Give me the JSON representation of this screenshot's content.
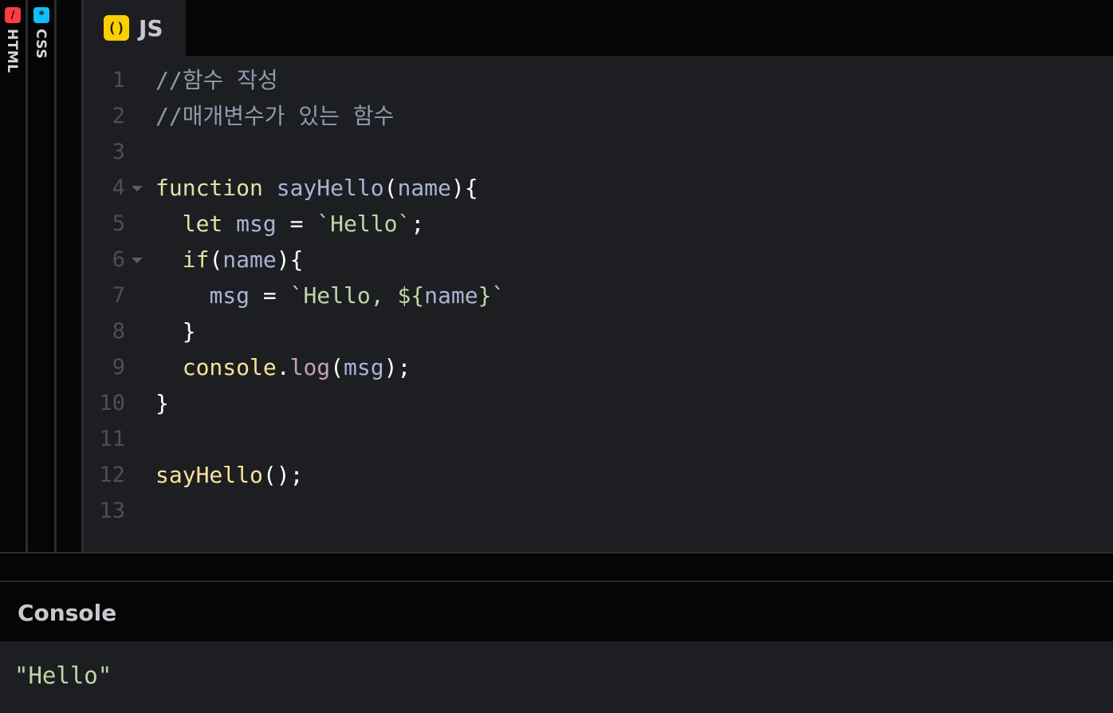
{
  "panels": {
    "html": {
      "label": "HTML",
      "icon": "html-icon",
      "color": "#ff3c41",
      "glyph": "/"
    },
    "css": {
      "label": "CSS",
      "icon": "css-icon",
      "color": "#0ebeff",
      "glyph": "*"
    }
  },
  "editor": {
    "tab": {
      "label": "JS",
      "icon": "js-icon",
      "color": "#fcd000",
      "glyph": "()"
    },
    "lines": [
      {
        "num": "1",
        "fold": false,
        "indent": "",
        "tokens": [
          {
            "t": "//함수 작성",
            "c": "comment"
          }
        ]
      },
      {
        "num": "2",
        "fold": false,
        "indent": "",
        "tokens": [
          {
            "t": "//매개변수가 있는 함수",
            "c": "comment"
          }
        ]
      },
      {
        "num": "3",
        "fold": false,
        "indent": "",
        "tokens": []
      },
      {
        "num": "4",
        "fold": true,
        "indent": "",
        "tokens": [
          {
            "t": "function",
            "c": "kw"
          },
          {
            "t": " ",
            "c": "punc"
          },
          {
            "t": "sayHello",
            "c": "var"
          },
          {
            "t": "(",
            "c": "punc"
          },
          {
            "t": "name",
            "c": "var"
          },
          {
            "t": "){",
            "c": "punc"
          }
        ]
      },
      {
        "num": "5",
        "fold": false,
        "indent": "  ",
        "tokens": [
          {
            "t": "let",
            "c": "kw"
          },
          {
            "t": " ",
            "c": "punc"
          },
          {
            "t": "msg",
            "c": "var"
          },
          {
            "t": " = ",
            "c": "punc"
          },
          {
            "t": "`Hello`",
            "c": "str"
          },
          {
            "t": ";",
            "c": "punc"
          }
        ]
      },
      {
        "num": "6",
        "fold": true,
        "indent": "  ",
        "tokens": [
          {
            "t": "if",
            "c": "kw"
          },
          {
            "t": "(",
            "c": "punc"
          },
          {
            "t": "name",
            "c": "var"
          },
          {
            "t": "){",
            "c": "punc"
          }
        ]
      },
      {
        "num": "7",
        "fold": false,
        "indent": "    ",
        "tokens": [
          {
            "t": "msg",
            "c": "var"
          },
          {
            "t": " = ",
            "c": "punc"
          },
          {
            "t": "`Hello, ${",
            "c": "str"
          },
          {
            "t": "name",
            "c": "var"
          },
          {
            "t": "}`",
            "c": "str"
          }
        ]
      },
      {
        "num": "8",
        "fold": false,
        "indent": "  ",
        "tokens": [
          {
            "t": "}",
            "c": "punc"
          }
        ]
      },
      {
        "num": "9",
        "fold": false,
        "indent": "  ",
        "tokens": [
          {
            "t": "console",
            "c": "fn"
          },
          {
            "t": ".",
            "c": "punc"
          },
          {
            "t": "log",
            "c": "method"
          },
          {
            "t": "(",
            "c": "punc"
          },
          {
            "t": "msg",
            "c": "var"
          },
          {
            "t": ");",
            "c": "punc"
          }
        ]
      },
      {
        "num": "10",
        "fold": false,
        "indent": "",
        "tokens": [
          {
            "t": "}",
            "c": "punc"
          }
        ]
      },
      {
        "num": "11",
        "fold": false,
        "indent": "",
        "tokens": []
      },
      {
        "num": "12",
        "fold": false,
        "indent": "",
        "tokens": [
          {
            "t": "sayHello",
            "c": "fn"
          },
          {
            "t": "();",
            "c": "punc"
          }
        ]
      },
      {
        "num": "13",
        "fold": false,
        "indent": "",
        "tokens": []
      }
    ]
  },
  "console": {
    "title": "Console",
    "output": "\"Hello\""
  },
  "colors": {
    "comment": "#8f9aad",
    "keyword": "#dde2a4",
    "function": "#f6e39a",
    "variable": "#a8b4d5",
    "string": "#bfd7a5",
    "method": "#c3a2b8",
    "background": "#1d1e22"
  }
}
